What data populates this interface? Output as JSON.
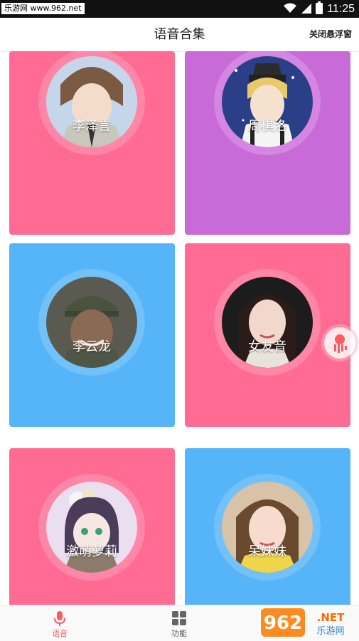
{
  "status_bar": {
    "watermark": "乐游网 www.962.net",
    "time": "11:25"
  },
  "header": {
    "title": "语音合集",
    "close_float_label": "关闭悬浮窗"
  },
  "cards": [
    {
      "name": "李泽言",
      "color": "#ff6b93"
    },
    {
      "name": "周棋洛",
      "color": "#c86bd8"
    },
    {
      "name": "李云龙",
      "color": "#56b4f8"
    },
    {
      "name": "女友音",
      "color": "#ff6b93"
    },
    {
      "name": "激萌萝莉",
      "color": "#ff6b93"
    },
    {
      "name": "呆妹妹",
      "color": "#56b4f8"
    }
  ],
  "bottom_nav": {
    "items": [
      {
        "label": "语音",
        "active": true,
        "icon": "mic-icon"
      },
      {
        "label": "功能",
        "active": false,
        "icon": "grid-icon"
      }
    ]
  },
  "logo": {
    "brand": "962.NET",
    "subtitle": "乐游网"
  },
  "colors": {
    "accent": "#ff5a5f",
    "pink": "#ff6b93",
    "purple": "#c86bd8",
    "blue": "#56b4f8"
  }
}
